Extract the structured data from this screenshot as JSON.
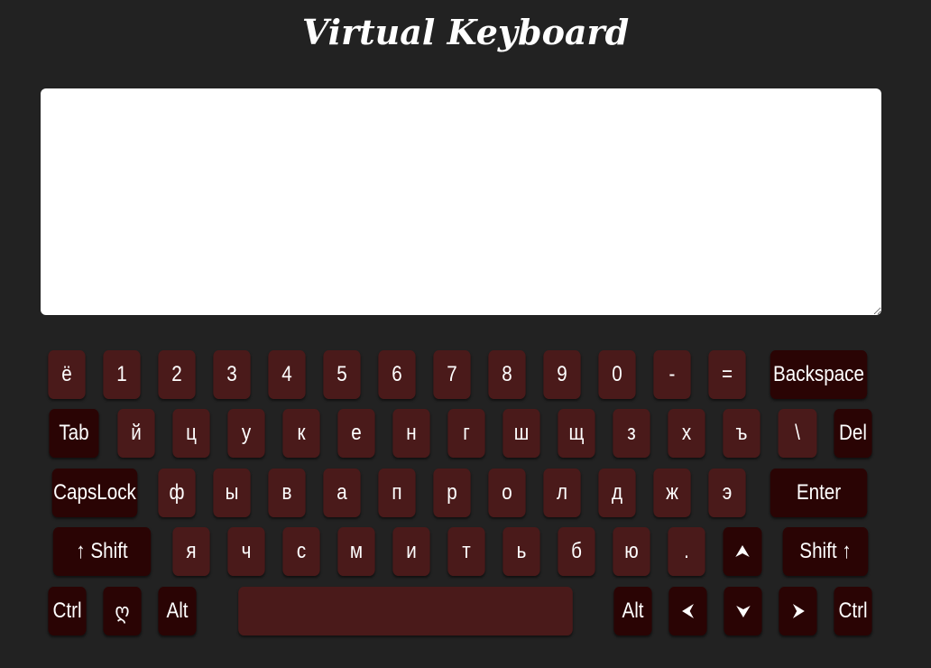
{
  "title": "Virtual Keyboard",
  "textarea": {
    "value": ""
  },
  "rows": [
    [
      {
        "label": "ё",
        "type": "char"
      },
      {
        "label": "1",
        "type": "char"
      },
      {
        "label": "2",
        "type": "char"
      },
      {
        "label": "3",
        "type": "char"
      },
      {
        "label": "4",
        "type": "char"
      },
      {
        "label": "5",
        "type": "char"
      },
      {
        "label": "6",
        "type": "char"
      },
      {
        "label": "7",
        "type": "char"
      },
      {
        "label": "8",
        "type": "char"
      },
      {
        "label": "9",
        "type": "char"
      },
      {
        "label": "0",
        "type": "char"
      },
      {
        "label": "-",
        "type": "char"
      },
      {
        "label": "=",
        "type": "char"
      },
      {
        "label": "Backspace",
        "type": "fn",
        "w": "wide"
      }
    ],
    [
      {
        "label": "Tab",
        "type": "fn"
      },
      {
        "label": "й",
        "type": "char"
      },
      {
        "label": "ц",
        "type": "char"
      },
      {
        "label": "у",
        "type": "char"
      },
      {
        "label": "к",
        "type": "char"
      },
      {
        "label": "е",
        "type": "char"
      },
      {
        "label": "н",
        "type": "char"
      },
      {
        "label": "г",
        "type": "char"
      },
      {
        "label": "ш",
        "type": "char"
      },
      {
        "label": "щ",
        "type": "char"
      },
      {
        "label": "з",
        "type": "char"
      },
      {
        "label": "х",
        "type": "char"
      },
      {
        "label": "ъ",
        "type": "char"
      },
      {
        "label": "\\",
        "type": "char"
      },
      {
        "label": "Del",
        "type": "fn"
      }
    ],
    [
      {
        "label": "CapsLock",
        "type": "fn"
      },
      {
        "label": "ф",
        "type": "char"
      },
      {
        "label": "ы",
        "type": "char"
      },
      {
        "label": "в",
        "type": "char"
      },
      {
        "label": "а",
        "type": "char"
      },
      {
        "label": "п",
        "type": "char"
      },
      {
        "label": "р",
        "type": "char"
      },
      {
        "label": "о",
        "type": "char"
      },
      {
        "label": "л",
        "type": "char"
      },
      {
        "label": "д",
        "type": "char"
      },
      {
        "label": "ж",
        "type": "char"
      },
      {
        "label": "э",
        "type": "char"
      },
      {
        "label": "Enter",
        "type": "fn"
      }
    ],
    [
      {
        "label": "↑ Shift",
        "type": "fn"
      },
      {
        "label": "я",
        "type": "char"
      },
      {
        "label": "ч",
        "type": "char"
      },
      {
        "label": "с",
        "type": "char"
      },
      {
        "label": "м",
        "type": "char"
      },
      {
        "label": "и",
        "type": "char"
      },
      {
        "label": "т",
        "type": "char"
      },
      {
        "label": "ь",
        "type": "char"
      },
      {
        "label": "б",
        "type": "char"
      },
      {
        "label": "ю",
        "type": "char"
      },
      {
        "label": ".",
        "type": "char"
      },
      {
        "label": "",
        "type": "fn",
        "icon": "arrow-up-icon"
      },
      {
        "label": "Shift ↑",
        "type": "fn"
      }
    ],
    [
      {
        "label": "Ctrl",
        "type": "fn"
      },
      {
        "label": "ღ",
        "type": "fn"
      },
      {
        "label": "Alt",
        "type": "fn"
      },
      {
        "label": "",
        "type": "char",
        "name": "space-key"
      },
      {
        "label": "Alt",
        "type": "fn"
      },
      {
        "label": "",
        "type": "fn",
        "icon": "arrow-left-icon"
      },
      {
        "label": "",
        "type": "fn",
        "icon": "arrow-down-icon"
      },
      {
        "label": "",
        "type": "fn",
        "icon": "arrow-right-icon"
      },
      {
        "label": "Ctrl",
        "type": "fn"
      }
    ]
  ],
  "colors": {
    "background": "#222222",
    "char_key": "#4a1a1a",
    "fn_key": "#2a0404",
    "text": "#ffffff"
  }
}
